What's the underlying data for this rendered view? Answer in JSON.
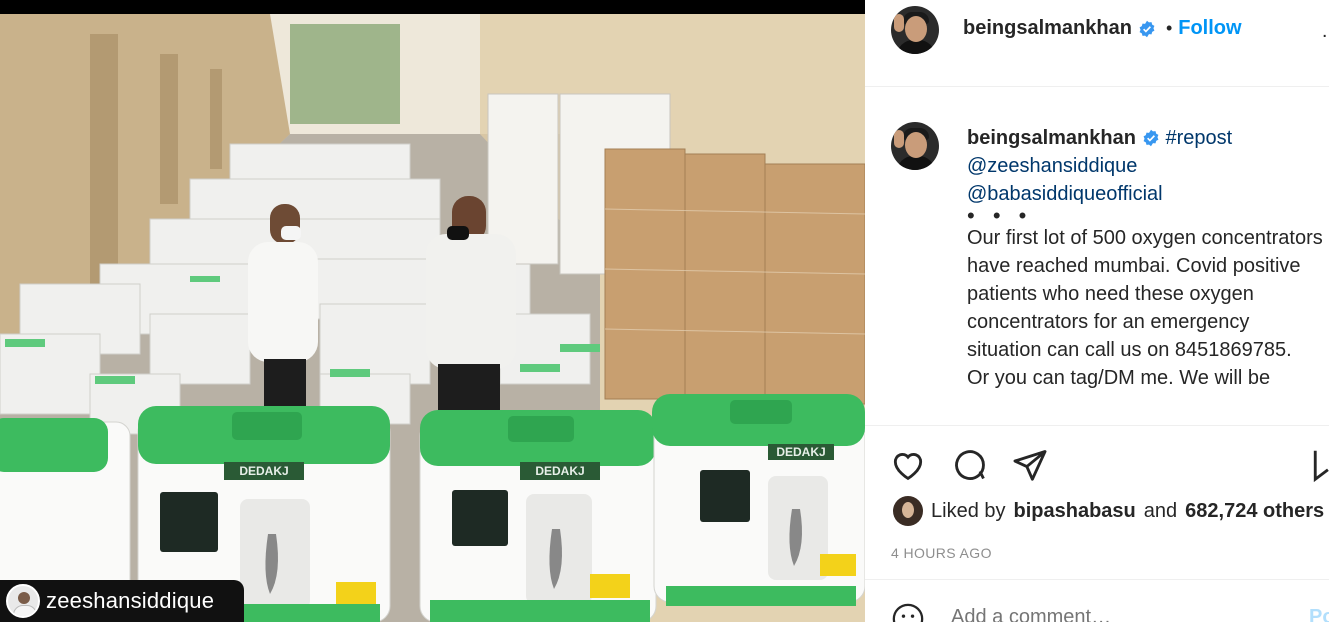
{
  "post": {
    "image_tag": "zeeshansiddique",
    "machine_brand": "DEDAKJ"
  },
  "header": {
    "username": "beingsalmankhan",
    "follow_label": "Follow",
    "separator": "•",
    "more_label": "…"
  },
  "caption": {
    "username": "beingsalmankhan",
    "hashtag": "#repost",
    "mention1": "@zeeshansiddique",
    "mention2": "@babasiddiqueofficial",
    "dots": "• • •",
    "text1": "Our first lot of 500 oxygen concentrators have reached mumbai. Covid positive patients who need these oxygen concentrators for an emergency situation can call us on 8451869785.",
    "text2": "Or you can tag/DM me. We will be"
  },
  "likes": {
    "prefix": "Liked by",
    "user": "bipashabasu",
    "middle": "and",
    "others": "682,724 others"
  },
  "timestamp": "4 HOURS AGO",
  "add_comment": {
    "placeholder": "Add a comment…",
    "post_label": "Post"
  },
  "colors": {
    "accent": "#0095f6",
    "verified": "#3897f0",
    "machine_green": "#3dbb5f"
  }
}
